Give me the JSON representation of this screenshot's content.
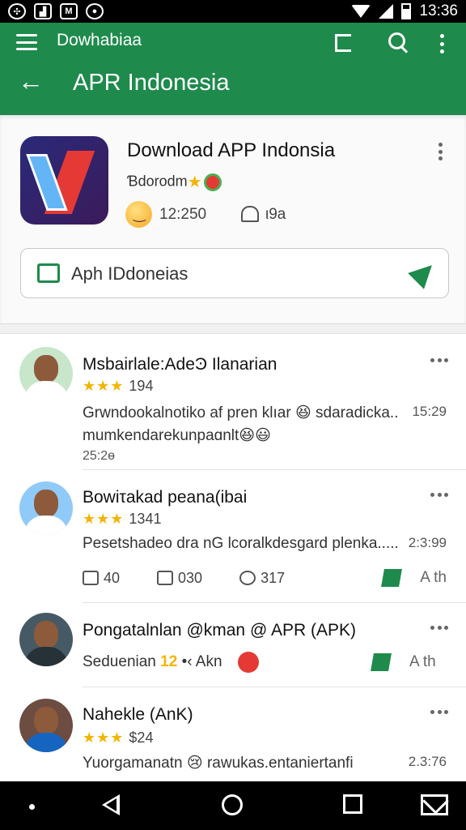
{
  "status_bar": {
    "time": "13:36",
    "icons": [
      "settings-icon",
      "image-icon",
      "mail-icon",
      "shield-icon",
      "wifi-icon",
      "signal-icon",
      "battery-icon"
    ]
  },
  "app_bar": {
    "top_title": "Dowhabiaa",
    "title": "APR Indonesia",
    "background": "#1e8a4c"
  },
  "app_card": {
    "name": "Download APP Indonsia",
    "subtitle": "Ɓdorodm",
    "rating_count": "12:250",
    "bell_count": "ι9a",
    "install_label": "Aph IDdoneias"
  },
  "reviews": [
    {
      "name": "Msbairlale:AdeϿ Ilanarian",
      "stars": "★★★",
      "star_count": "194",
      "text": "Grwndookalnotiko af pren klıar 😆 sdaradicka..",
      "text2": "mumkendarekunpaɑnlt😆😃",
      "date": "25:2ɵ",
      "time": "15:29"
    },
    {
      "name": "Bowiτakad peana(ibai",
      "stars": "★★★",
      "star_count": "1341",
      "text": "Pesetshadeo dra nG lcoralkdesgard plenka.....",
      "time": "2:3:99",
      "stats": {
        "likes": "40",
        "reposts": "030",
        "comments": "317",
        "action": "A th"
      }
    },
    {
      "name": "Pongatalnlan @kman @ APR (APK)",
      "subtext": "Seduenian",
      "badge": "12",
      "tail": "•‹ Akn",
      "action": "A th"
    },
    {
      "name": "Nahekle (AnK)",
      "stars": "★★★",
      "star_count": "$24",
      "text": "Yuorgamanatn 😢 rawukas.entaniertanfi",
      "time": "2.3:76"
    }
  ],
  "nav_bar": {
    "icons": [
      "dot-icon",
      "back-icon",
      "home-icon",
      "recents-icon",
      "mail-icon"
    ]
  }
}
